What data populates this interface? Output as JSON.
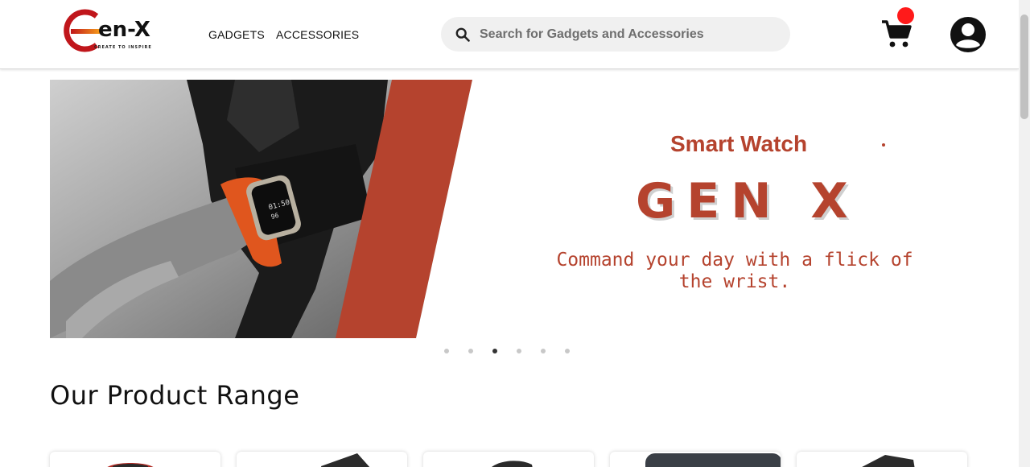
{
  "header": {
    "logo": {
      "text": "en-X",
      "tagline": "CREATE TO INSPIRE"
    },
    "nav": {
      "gadgets": "GADGETS",
      "accessories": "ACCESSORIES"
    },
    "search": {
      "placeholder": "Search for Gadgets and Accessories",
      "value": ""
    },
    "cart": {
      "icon": "cart-icon",
      "badge": "",
      "badge_color": "#ff1a1a"
    },
    "account": {
      "icon": "user-circle-icon"
    }
  },
  "hero": {
    "subtitle": "Smart Watch",
    "title": "GEN X",
    "tagline": "Command your day with a flick of the wrist.",
    "accent_color": "#b5432e",
    "slides_count": 6,
    "active_slide": 3
  },
  "section": {
    "title": "Our Product Range"
  },
  "products": [
    {
      "thumb": "red-device"
    },
    {
      "thumb": "dark-device"
    },
    {
      "thumb": "dark-device"
    },
    {
      "thumb": "dark-device"
    },
    {
      "thumb": "dark-device"
    }
  ]
}
